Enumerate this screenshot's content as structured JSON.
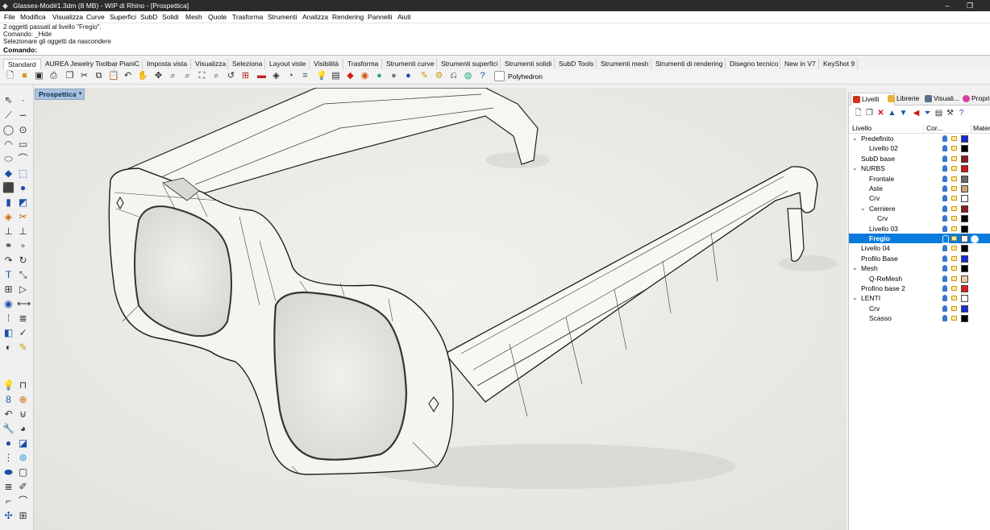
{
  "window": {
    "title": "Glasses-Mod#1.3dm (8 MB) - WIP di Rhino - [Prospettica]"
  },
  "menu": [
    "File",
    "Modifica",
    "Visualizza",
    "Curve",
    "Superfici",
    "SubD",
    "Solidi",
    "Mesh",
    "Quote",
    "Trasforma",
    "Strumenti",
    "Analizza",
    "Rendering",
    "Pannelli",
    "Aiuti"
  ],
  "command_history": [
    "2 oggetti passati al livello \"Fregio\".",
    "Comando: _Hide",
    "Selezionare gli oggetti da nascondere"
  ],
  "command_prompt": {
    "label": "Comando:",
    "value": ""
  },
  "tabs": [
    "Standard",
    "AUREA Jewelry Toolbar",
    "PianiC",
    "Imposta vista",
    "Visualizza",
    "Seleziona",
    "Layout viste",
    "Visibilità",
    "Trasforma",
    "Strumenti curve",
    "Strumenti superfici",
    "Strumenti solidi",
    "SubD Tools",
    "Strumenti mesh",
    "Strumenti di rendering",
    "Disegno tecnico",
    "New in V7",
    "KeyShot 9"
  ],
  "toolbar": {
    "polyhedron_label": "Polyhedron"
  },
  "viewport": {
    "label": "Prospettica"
  },
  "panel": {
    "tabs": [
      "Livelli",
      "Librerie",
      "Visuali...",
      "Propri..."
    ],
    "columns": {
      "layer": "Livello",
      "color": "Cor...",
      "material": "Materia"
    },
    "layers": [
      {
        "name": "Predefinito",
        "level": 0,
        "expand": "down",
        "color": "#1b2bd6"
      },
      {
        "name": "Livello 02",
        "level": 1,
        "expand": "",
        "color": "#000000"
      },
      {
        "name": "SubD base",
        "level": 0,
        "expand": "",
        "color": "#8b1a1a"
      },
      {
        "name": "NURBS",
        "level": 0,
        "expand": "down",
        "color": "#d01515"
      },
      {
        "name": "Frontale",
        "level": 1,
        "expand": "",
        "color": "#6a6a6a"
      },
      {
        "name": "Aste",
        "level": 1,
        "expand": "",
        "color": "#c9a47a"
      },
      {
        "name": "Crv",
        "level": 1,
        "expand": "",
        "color": "#ffffff"
      },
      {
        "name": "Cerniere",
        "level": 1,
        "expand": "down",
        "color": "#8b1a1a"
      },
      {
        "name": "Crv",
        "level": 2,
        "expand": "",
        "color": "#000000"
      },
      {
        "name": "Livello 03",
        "level": 1,
        "expand": "",
        "color": "#000000"
      },
      {
        "name": "Fregio",
        "level": 1,
        "expand": "",
        "color": "#ffffff",
        "selected": true
      },
      {
        "name": "Livello 04",
        "level": 0,
        "expand": "",
        "color": "#000000"
      },
      {
        "name": "Profilo Base",
        "level": 0,
        "expand": "",
        "color": "#1b2bd6"
      },
      {
        "name": "Mesh",
        "level": 0,
        "expand": "down",
        "color": "#000000"
      },
      {
        "name": "Q-ReMesh",
        "level": 1,
        "expand": "",
        "color": "#f2c9a0"
      },
      {
        "name": "Profino base 2",
        "level": 0,
        "expand": "",
        "color": "#e01b1b"
      },
      {
        "name": "LENTI",
        "level": 0,
        "expand": "down",
        "color": "#ffffff"
      },
      {
        "name": "Crv",
        "level": 1,
        "expand": "",
        "color": "#1b2bd6"
      },
      {
        "name": "Scasso",
        "level": 1,
        "expand": "",
        "color": "#000000"
      }
    ]
  }
}
